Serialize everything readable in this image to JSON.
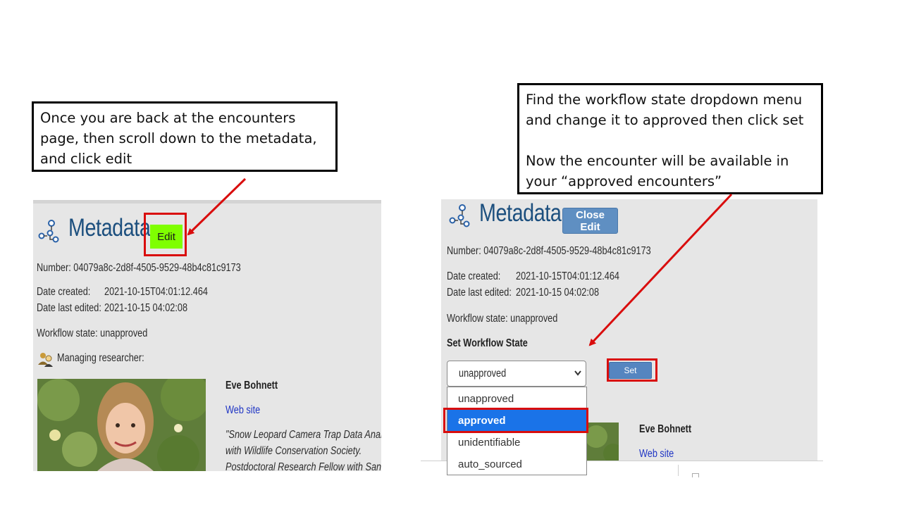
{
  "instructions": {
    "left": [
      "Once you are back at the encounters",
      "page, then scroll down to the metadata,",
      "and click edit"
    ],
    "right": [
      "Find the workflow state dropdown menu",
      "and change it to approved then click set",
      "",
      "Now the encounter will be available in",
      "your “approved encounters”"
    ]
  },
  "left_panel": {
    "title": "Metadata",
    "edit_label": "Edit",
    "number": "Number: 04079a8c-2d8f-4505-9529-48b4c81c9173",
    "date_created_label": "Date created:",
    "date_created_value": "2021-10-15T04:01:12.464",
    "date_edited_label": "Date last edited:",
    "date_edited_value": "2021-10-15 04:02:08",
    "workflow_state": "Workflow state: unapproved",
    "managing_researcher": "Managing researcher:",
    "researcher_name": "Eve Bohnett",
    "website_link": "Web site",
    "bio_lines": [
      "\"Snow Leopard Camera Trap Data Analys",
      "with Wildlife Conservation Society.",
      "Postdoctoral Research Fellow with San"
    ]
  },
  "right_panel": {
    "title": "Metadata",
    "close_edit_label": "Close Edit",
    "number": "Number: 04079a8c-2d8f-4505-9529-48b4c81c9173",
    "date_created_label": "Date created:",
    "date_created_value": "2021-10-15T04:01:12.464",
    "date_edited_label": "Date last edited:",
    "date_edited_value": "2021-10-15 04:02:08",
    "workflow_state": "Workflow state: unapproved",
    "set_workflow_heading": "Set Workflow State",
    "select_value": "unapproved",
    "set_label": "Set",
    "options": [
      "unapproved",
      "approved",
      "unidentifiable",
      "auto_sourced"
    ],
    "highlighted_option": "approved",
    "researcher_name": "Eve Bohnett",
    "website_link": "Web site"
  },
  "colors": {
    "title_blue": "#1c4f7e",
    "edit_green": "#7fff00",
    "highlight_red": "#d90d0d",
    "link_blue": "#1f35c4",
    "option_selected": "#1a73e8"
  },
  "icons": [
    "hierarchy-icon",
    "researcher-icon",
    "chevron-down-icon"
  ]
}
